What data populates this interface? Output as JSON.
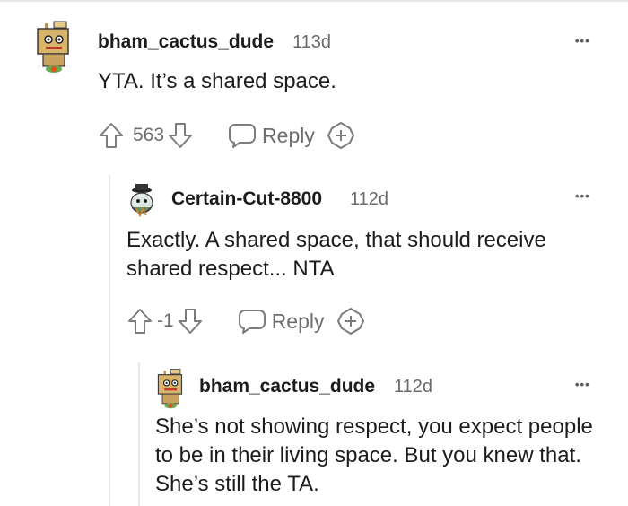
{
  "comments": [
    {
      "username": "bham_cactus_dude",
      "age": "113d",
      "text": "YTA. It’s a shared space.",
      "score": "563",
      "reply_label": "Reply",
      "more_label": "•••"
    },
    {
      "username": "Certain-Cut-8800",
      "age": "112d",
      "text": "Exactly. A shared space, that should receive shared respect... NTA",
      "score": "-1",
      "reply_label": "Reply",
      "more_label": "•••"
    },
    {
      "username": "bham_cactus_dude",
      "age": "112d",
      "text": "She’s not showing respect, you expect people to be in their living space. But you knew that. She’s still the TA.",
      "more_label": "•••"
    }
  ],
  "icons": {
    "upvote": "arrow-up-outline-icon",
    "downvote": "arrow-down-outline-icon",
    "reply": "speech-bubble-icon",
    "award": "award-plus-icon",
    "more": "more-horizontal-icon"
  },
  "colors": {
    "text": "#1c1c1c",
    "meta": "#6a6a6a",
    "icon": "#7c7c7c",
    "thread_line": "#e9e9e9"
  }
}
